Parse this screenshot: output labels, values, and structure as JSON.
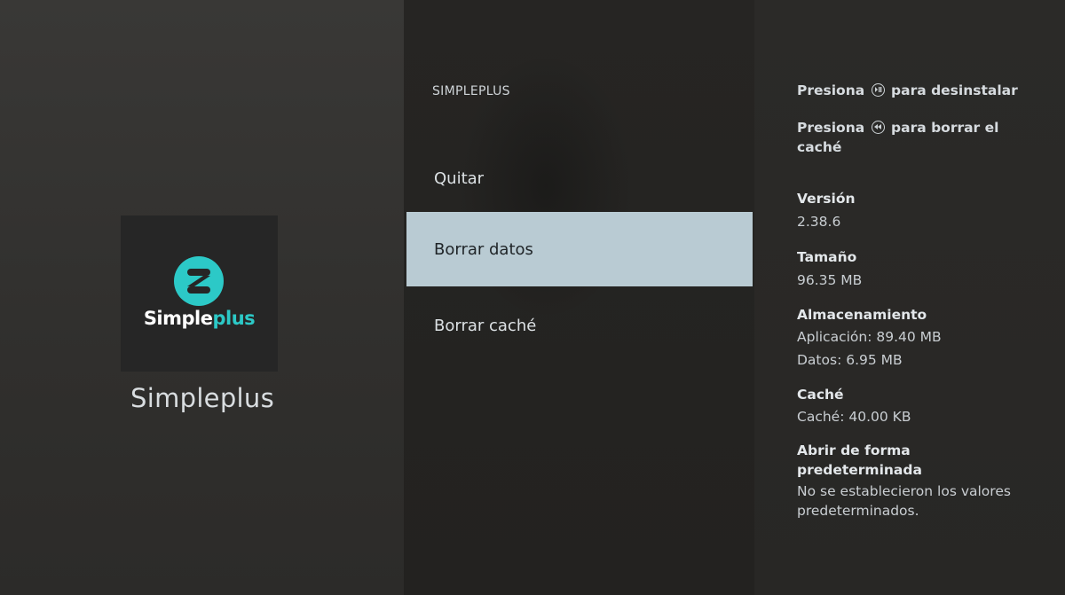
{
  "app": {
    "name": "Simpleplus",
    "logo_word_main": "Simple",
    "logo_word_accent": "plus",
    "accent_color": "#2cc9c7"
  },
  "menu": {
    "header": "SIMPLEPLUS",
    "items": [
      {
        "label": "Quitar",
        "selected": false
      },
      {
        "label": "Borrar datos",
        "selected": true
      },
      {
        "label": "Borrar caché",
        "selected": false
      }
    ]
  },
  "info": {
    "hint_uninstall_prefix": "Presiona",
    "hint_uninstall_icon": "play-pause-icon",
    "hint_uninstall_suffix": "para desinstalar",
    "hint_cache_prefix": "Presiona",
    "hint_cache_icon": "rewind-icon",
    "hint_cache_suffix": "para borrar el caché",
    "version_label": "Versión",
    "version_value": "2.38.6",
    "size_label": "Tamaño",
    "size_value": "96.35 MB",
    "storage_label": "Almacenamiento",
    "storage_app": "Aplicación: 89.40 MB",
    "storage_data": "Datos: 6.95 MB",
    "cache_label": "Caché",
    "cache_value": "Caché: 40.00 KB",
    "default_label": "Abrir de forma predeterminada",
    "default_value": "No se establecieron los valores predeterminados."
  },
  "colors": {
    "selected_bg": "#b9cbd3",
    "background": "#2a2927"
  }
}
